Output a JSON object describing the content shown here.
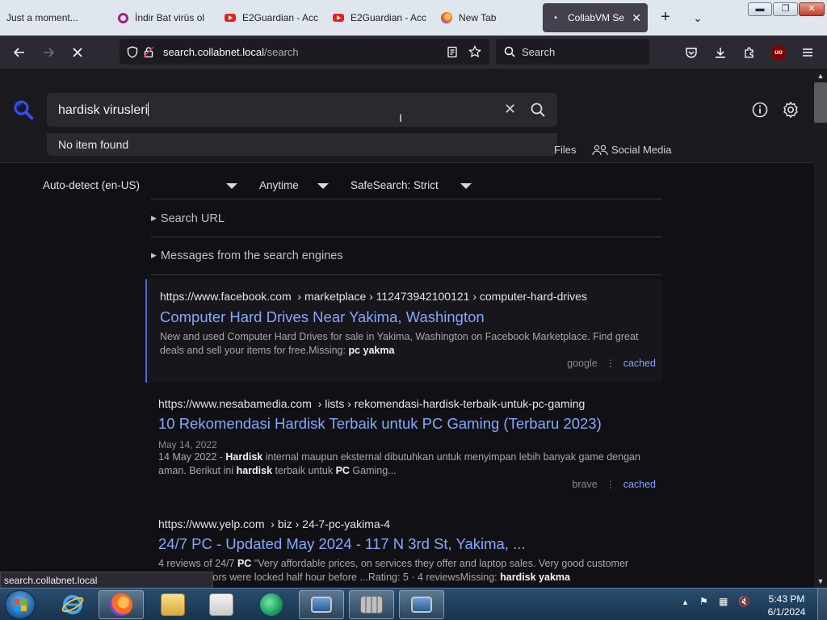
{
  "browser": {
    "tabs": [
      {
        "label": "Just a moment...",
        "icon": "none"
      },
      {
        "label": "İndir Bat virüs ol",
        "icon": "opera-icon"
      },
      {
        "label": "E2Guardian - Acc",
        "icon": "youtube-icon"
      },
      {
        "label": "E2Guardian - Acc",
        "icon": "youtube-icon"
      },
      {
        "label": "New Tab",
        "icon": "firefox-icon"
      },
      {
        "label": "CollabVM Se",
        "icon": "loading-icon"
      }
    ],
    "url_domain": "search.collabnet.local",
    "url_path": "/search",
    "search_placeholder": "Search",
    "status_url": "search.collabnet.local"
  },
  "search": {
    "query": "hardisk virusleri",
    "suggestion_empty": "No item found"
  },
  "categories": {
    "files": "Files",
    "social_media": "Social Media"
  },
  "filters": {
    "language": "Auto-detect (en-US)",
    "time": "Anytime",
    "safesearch": "SafeSearch: Strict"
  },
  "toggles": {
    "search_url": "Search URL",
    "messages": "Messages from the search engines"
  },
  "results": [
    {
      "domain": "https://www.facebook.com",
      "path": "› marketplace › 112473942100121 › computer-hard-drives",
      "title": "Computer Hard Drives Near Yakima, Washington",
      "date": "",
      "snippet_parts": [
        {
          "t": "New and used Computer Hard Drives for sale in Yakima, Washington on Facebook Marketplace. Find great deals and sell your items for free.Missing: ",
          "b": false
        },
        {
          "t": "pc yakma",
          "b": true
        }
      ],
      "engine": "google",
      "cached": "cached"
    },
    {
      "domain": "https://www.nesabamedia.com",
      "path": "› lists › rekomendasi-hardisk-terbaik-untuk-pc-gaming",
      "title": "10 Rekomendasi Hardisk Terbaik untuk PC Gaming (Terbaru 2023)",
      "date": "May 14, 2022",
      "snippet_parts": [
        {
          "t": "14 May 2022 - ",
          "b": false
        },
        {
          "t": "Hardisk",
          "b": true
        },
        {
          "t": " internal maupun eksternal dibutuhkan untuk menyimpan lebih banyak game dengan aman. Berikut ini ",
          "b": false
        },
        {
          "t": "hardisk",
          "b": true
        },
        {
          "t": " terbaik untuk ",
          "b": false
        },
        {
          "t": "PC",
          "b": true
        },
        {
          "t": " Gaming...",
          "b": false
        }
      ],
      "engine": "brave",
      "cached": "cached"
    },
    {
      "domain": "https://www.yelp.com",
      "path": "› biz › 24-7-pc-yakima-4",
      "title": "24/7 PC - Updated May 2024 - 117 N 3rd St, Yakima, ...",
      "date": "",
      "snippet_parts": [
        {
          "t": "4 reviews of 24/7 ",
          "b": false
        },
        {
          "t": "PC",
          "b": true
        },
        {
          "t": " \"Very affordable prices, on services they offer and laptop sales. Very good customer service... doors were locked half hour before ...Rating: 5 · 4 reviewsMissing: ",
          "b": false
        },
        {
          "t": "hardisk yakma",
          "b": true
        }
      ],
      "engine": "",
      "cached": ""
    }
  ],
  "taskbar": {
    "time": "5:43 PM",
    "date": "6/1/2024"
  },
  "colors": {
    "accent_link": "#85a8ff",
    "active_border": "#4d6bd6",
    "page_bg": "#111115"
  }
}
